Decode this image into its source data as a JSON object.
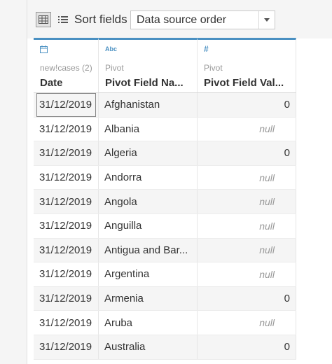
{
  "toolbar": {
    "sort_label": "Sort fields",
    "sort_value": "Data source order",
    "grid_view_icon": "grid-view-icon",
    "list_view_icon": "list-view-icon"
  },
  "columns": [
    {
      "type_icon": "calendar-icon",
      "source": "new!cases (2)",
      "name": "Date"
    },
    {
      "type_icon": "Abc",
      "source": "Pivot",
      "name": "Pivot Field Na..."
    },
    {
      "type_icon": "#",
      "source": "Pivot",
      "name": "Pivot Field Val..."
    }
  ],
  "rows": [
    {
      "date": "31/12/2019",
      "name": "Afghanistan",
      "value": "0"
    },
    {
      "date": "31/12/2019",
      "name": "Albania",
      "value": "null"
    },
    {
      "date": "31/12/2019",
      "name": "Algeria",
      "value": "0"
    },
    {
      "date": "31/12/2019",
      "name": "Andorra",
      "value": "null"
    },
    {
      "date": "31/12/2019",
      "name": "Angola",
      "value": "null"
    },
    {
      "date": "31/12/2019",
      "name": "Anguilla",
      "value": "null"
    },
    {
      "date": "31/12/2019",
      "name": "Antigua and Bar...",
      "value": "null"
    },
    {
      "date": "31/12/2019",
      "name": "Argentina",
      "value": "null"
    },
    {
      "date": "31/12/2019",
      "name": "Armenia",
      "value": "0"
    },
    {
      "date": "31/12/2019",
      "name": "Aruba",
      "value": "null"
    },
    {
      "date": "31/12/2019",
      "name": "Australia",
      "value": "0"
    }
  ],
  "colors": {
    "accent": "#4a90c2",
    "null_text": "#999999"
  }
}
